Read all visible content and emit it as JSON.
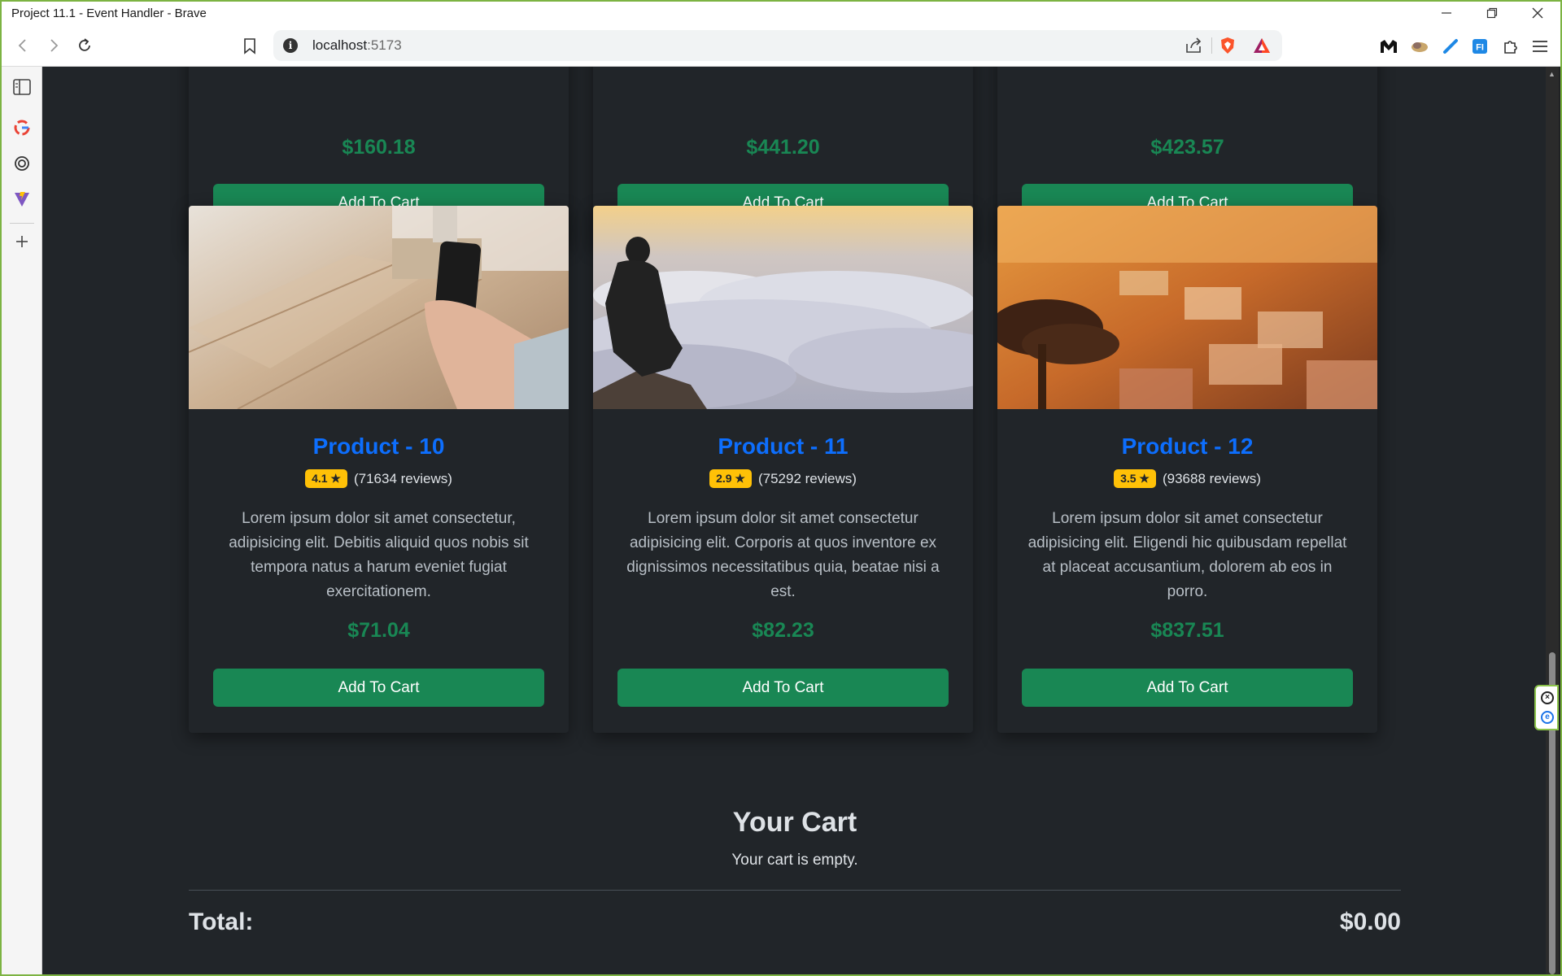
{
  "window": {
    "title": "Project 11.1 - Event Handler - Brave"
  },
  "address_bar": {
    "host": "localhost",
    "port": ":5173"
  },
  "top_products": [
    {
      "price": "$160.18",
      "button": "Add To Cart"
    },
    {
      "price": "$441.20",
      "button": "Add To Cart"
    },
    {
      "price": "$423.57",
      "button": "Add To Cart"
    }
  ],
  "products": [
    {
      "name": "Product - 10",
      "rating": "4.1 ★",
      "reviews": "(71634 reviews)",
      "description": "Lorem ipsum dolor sit amet consectetur, adipisicing elit. Debitis aliquid quos nobis sit tempora natus a harum eveniet fugiat exercitationem.",
      "price": "$71.04",
      "button": "Add To Cart"
    },
    {
      "name": "Product - 11",
      "rating": "2.9 ★",
      "reviews": "(75292 reviews)",
      "description": "Lorem ipsum dolor sit amet consectetur adipisicing elit. Corporis at quos inventore ex dignissimos necessitatibus quia, beatae nisi a est.",
      "price": "$82.23",
      "button": "Add To Cart"
    },
    {
      "name": "Product - 12",
      "rating": "3.5 ★",
      "reviews": "(93688 reviews)",
      "description": "Lorem ipsum dolor sit amet consectetur adipisicing elit. Eligendi hic quibusdam repellat at placeat accusantium, dolorem ab eos in porro.",
      "price": "$837.51",
      "button": "Add To Cart"
    }
  ],
  "cart": {
    "title": "Your Cart",
    "empty_message": "Your cart is empty.",
    "total_label": "Total:",
    "total_value": "$0.00"
  },
  "colors": {
    "background": "#212529",
    "product_name": "#0d6efd",
    "price": "#198754",
    "button": "#198754",
    "rating_badge": "#ffc107"
  }
}
